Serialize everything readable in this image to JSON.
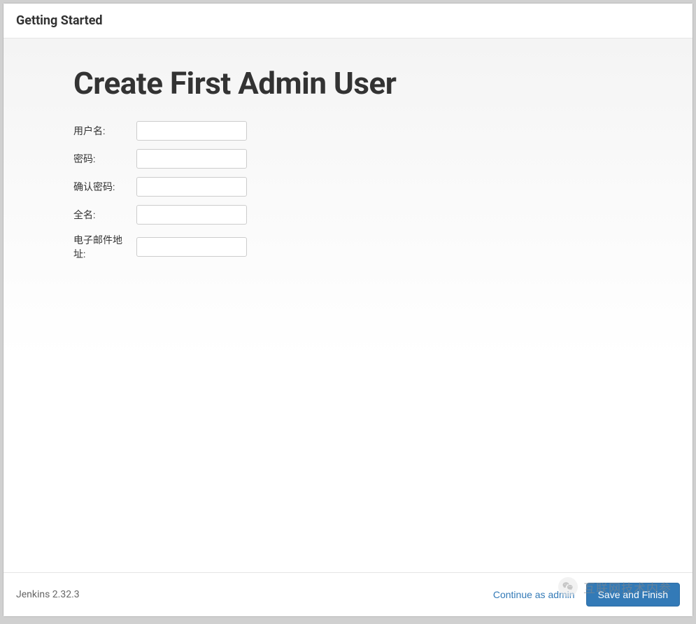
{
  "header": {
    "title": "Getting Started"
  },
  "main": {
    "title": "Create First Admin User",
    "fields": {
      "username": {
        "label": "用户名:",
        "value": ""
      },
      "password": {
        "label": "密码:",
        "value": ""
      },
      "confirm_password": {
        "label": "确认密码:",
        "value": ""
      },
      "fullname": {
        "label": "全名:",
        "value": ""
      },
      "email": {
        "label": "电子邮件地址:",
        "value": ""
      }
    }
  },
  "footer": {
    "version": "Jenkins 2.32.3",
    "continue_as_admin": "Continue as admin",
    "save_and_finish": "Save and Finish"
  },
  "watermark": {
    "text": "互联网技术内参"
  }
}
